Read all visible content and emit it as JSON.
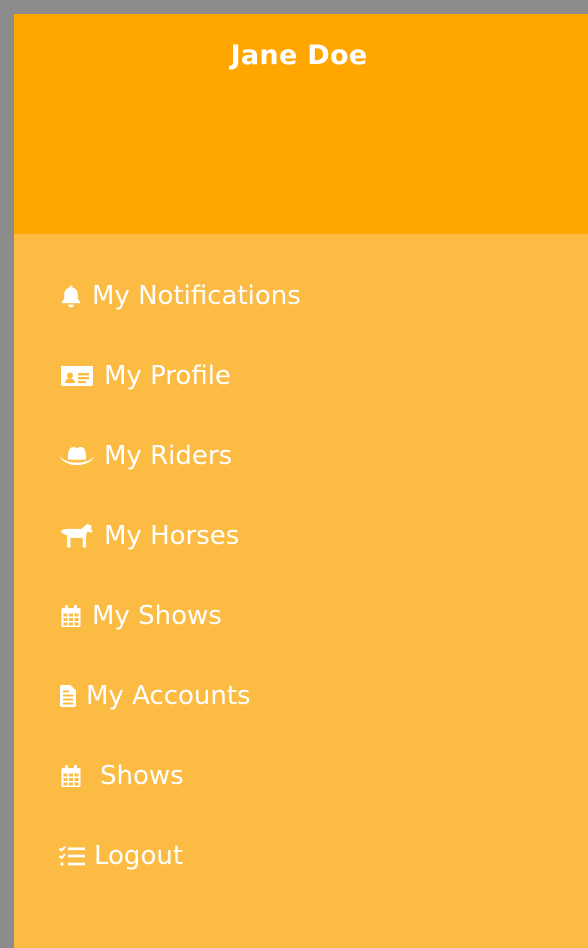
{
  "header": {
    "user_name": "Jane Doe",
    "background_color": "#ffa600"
  },
  "menu": {
    "background_color": "#fcbb42",
    "items": [
      {
        "label": "My Notifications",
        "icon": "bell-icon"
      },
      {
        "label": "My Profile",
        "icon": "id-card-icon"
      },
      {
        "label": "My Riders",
        "icon": "cowboy-hat-icon"
      },
      {
        "label": "My Horses",
        "icon": "horse-icon"
      },
      {
        "label": "My Shows",
        "icon": "calendar-icon"
      },
      {
        "label": "My Accounts",
        "icon": "document-icon"
      },
      {
        "label": "Shows",
        "icon": "calendar-icon"
      },
      {
        "label": "Logout",
        "icon": "checklist-icon"
      }
    ]
  }
}
